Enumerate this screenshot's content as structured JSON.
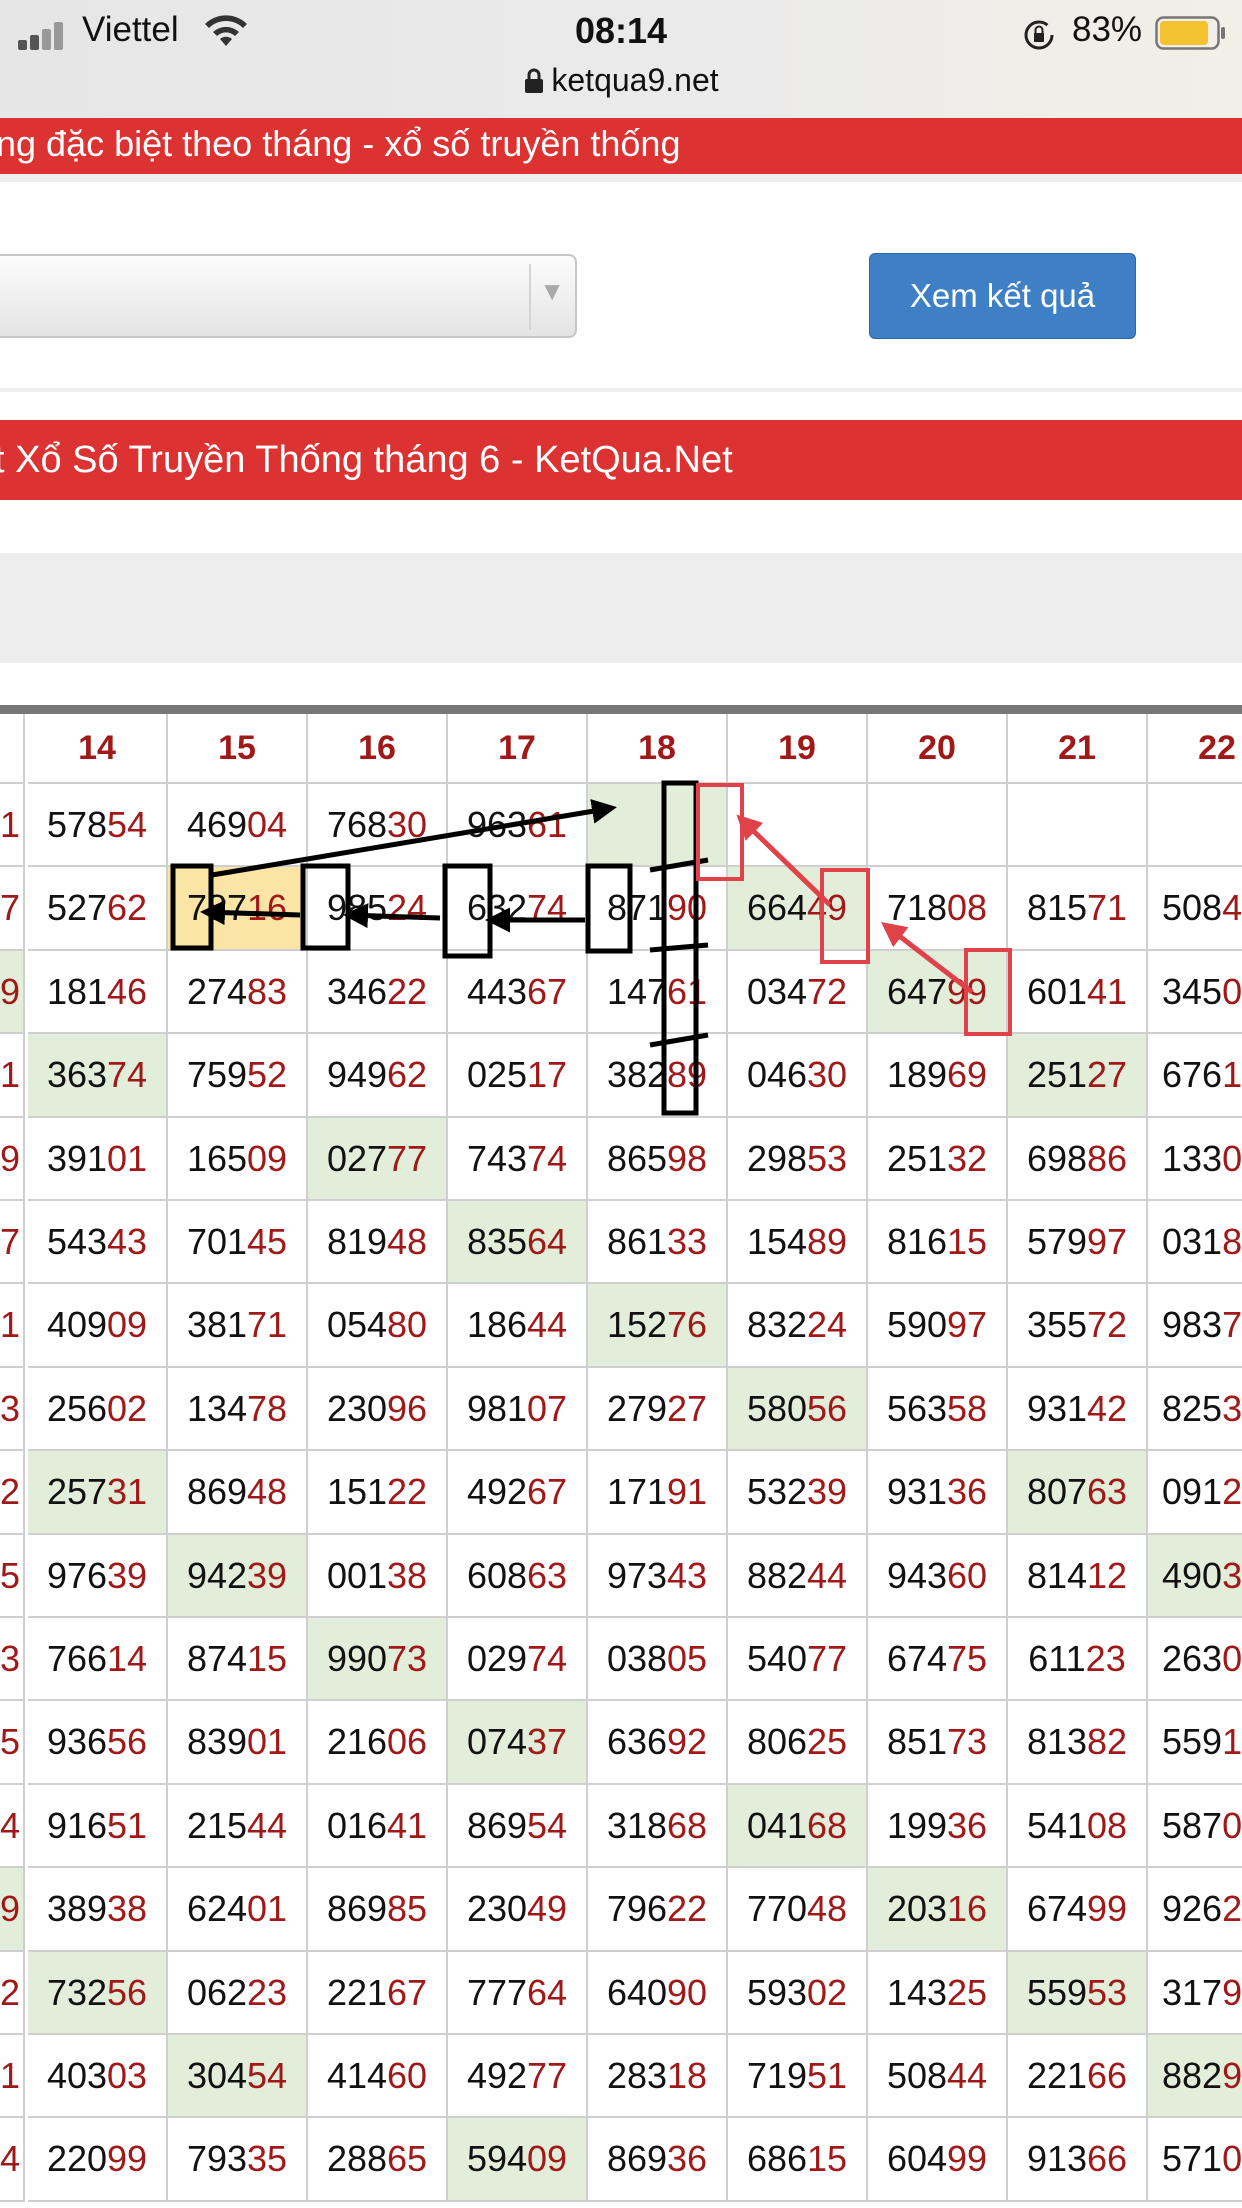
{
  "status_bar": {
    "carrier": "Viettel",
    "time": "08:14",
    "battery": "83%",
    "url": "ketqua9.net",
    "icons": [
      "signal-icon",
      "wifi-icon",
      "rotation-lock-icon",
      "battery-icon",
      "lock-icon"
    ]
  },
  "banner_top": {
    "title": "ng đặc biệt theo tháng - xổ số truyền thống"
  },
  "filter": {
    "select_value": "",
    "submit_label": "Xem kết quả"
  },
  "banner_results": {
    "title": "t Xổ Số Truyền Thống tháng 6 - KetQua.Net"
  },
  "colors": {
    "banner": "#dc3232",
    "button": "#3f7fc5",
    "tail_digits": "#a01818",
    "highlight": "#e2eed9",
    "highlight_yellow": "#fbe5a6",
    "annotation_red": "#e0424a",
    "annotation_black": "#000000"
  },
  "table": {
    "headers": [
      "",
      "14",
      "15",
      "16",
      "17",
      "18",
      "19",
      "20",
      "21",
      "22"
    ],
    "rows": [
      [
        {
          "l": "",
          "t": "1"
        },
        {
          "l": "578",
          "t": "54"
        },
        {
          "l": "469",
          "t": "04"
        },
        {
          "l": "768",
          "t": "30"
        },
        {
          "l": "963",
          "t": "61"
        },
        {
          "l": "",
          "t": "",
          "h": 1
        },
        {
          "l": "",
          "t": ""
        },
        {
          "l": "",
          "t": ""
        },
        {
          "l": "",
          "t": ""
        },
        {
          "l": "",
          "t": ""
        }
      ],
      [
        {
          "l": "",
          "t": "7"
        },
        {
          "l": "527",
          "t": "62"
        },
        {
          "l": "787",
          "t": "16",
          "h": 2
        },
        {
          "l": "985",
          "t": "24"
        },
        {
          "l": "632",
          "t": "74"
        },
        {
          "l": "871",
          "t": "90"
        },
        {
          "l": "664",
          "t": "49",
          "h": 1
        },
        {
          "l": "718",
          "t": "08"
        },
        {
          "l": "815",
          "t": "71"
        },
        {
          "l": "508",
          "t": "4"
        }
      ],
      [
        {
          "l": "",
          "t": "9",
          "h": 1
        },
        {
          "l": "181",
          "t": "46"
        },
        {
          "l": "274",
          "t": "83"
        },
        {
          "l": "346",
          "t": "22"
        },
        {
          "l": "443",
          "t": "67"
        },
        {
          "l": "147",
          "t": "61"
        },
        {
          "l": "034",
          "t": "72"
        },
        {
          "l": "647",
          "t": "99",
          "h": 1
        },
        {
          "l": "601",
          "t": "41"
        },
        {
          "l": "345",
          "t": "0"
        }
      ],
      [
        {
          "l": "",
          "t": "1"
        },
        {
          "l": "363",
          "t": "74",
          "h": 1
        },
        {
          "l": "759",
          "t": "52"
        },
        {
          "l": "949",
          "t": "62"
        },
        {
          "l": "025",
          "t": "17"
        },
        {
          "l": "382",
          "t": "89"
        },
        {
          "l": "046",
          "t": "30"
        },
        {
          "l": "189",
          "t": "69"
        },
        {
          "l": "251",
          "t": "27",
          "h": 1
        },
        {
          "l": "676",
          "t": "1"
        }
      ],
      [
        {
          "l": "",
          "t": "9"
        },
        {
          "l": "391",
          "t": "01"
        },
        {
          "l": "165",
          "t": "09"
        },
        {
          "l": "027",
          "t": "77",
          "h": 1
        },
        {
          "l": "743",
          "t": "74"
        },
        {
          "l": "865",
          "t": "98"
        },
        {
          "l": "298",
          "t": "53"
        },
        {
          "l": "251",
          "t": "32"
        },
        {
          "l": "698",
          "t": "86"
        },
        {
          "l": "133",
          "t": "0"
        }
      ],
      [
        {
          "l": "",
          "t": "7"
        },
        {
          "l": "543",
          "t": "43"
        },
        {
          "l": "701",
          "t": "45"
        },
        {
          "l": "819",
          "t": "48"
        },
        {
          "l": "835",
          "t": "64",
          "h": 1
        },
        {
          "l": "861",
          "t": "33"
        },
        {
          "l": "154",
          "t": "89"
        },
        {
          "l": "816",
          "t": "15"
        },
        {
          "l": "579",
          "t": "97"
        },
        {
          "l": "031",
          "t": "8"
        }
      ],
      [
        {
          "l": "",
          "t": "1"
        },
        {
          "l": "409",
          "t": "09"
        },
        {
          "l": "381",
          "t": "71"
        },
        {
          "l": "054",
          "t": "80"
        },
        {
          "l": "186",
          "t": "44"
        },
        {
          "l": "152",
          "t": "76",
          "h": 1
        },
        {
          "l": "832",
          "t": "24"
        },
        {
          "l": "590",
          "t": "97"
        },
        {
          "l": "355",
          "t": "72"
        },
        {
          "l": "983",
          "t": "7"
        }
      ],
      [
        {
          "l": "",
          "t": "3"
        },
        {
          "l": "256",
          "t": "02"
        },
        {
          "l": "134",
          "t": "78"
        },
        {
          "l": "230",
          "t": "96"
        },
        {
          "l": "981",
          "t": "07"
        },
        {
          "l": "279",
          "t": "27"
        },
        {
          "l": "580",
          "t": "56",
          "h": 1
        },
        {
          "l": "563",
          "t": "58"
        },
        {
          "l": "931",
          "t": "42"
        },
        {
          "l": "825",
          "t": "3"
        }
      ],
      [
        {
          "l": "",
          "t": "2"
        },
        {
          "l": "257",
          "t": "31",
          "h": 1
        },
        {
          "l": "869",
          "t": "48"
        },
        {
          "l": "151",
          "t": "22"
        },
        {
          "l": "492",
          "t": "67"
        },
        {
          "l": "171",
          "t": "91"
        },
        {
          "l": "532",
          "t": "39"
        },
        {
          "l": "931",
          "t": "36"
        },
        {
          "l": "807",
          "t": "63",
          "h": 1
        },
        {
          "l": "091",
          "t": "2"
        }
      ],
      [
        {
          "l": "",
          "t": "5"
        },
        {
          "l": "976",
          "t": "39"
        },
        {
          "l": "942",
          "t": "39",
          "h": 1
        },
        {
          "l": "001",
          "t": "38"
        },
        {
          "l": "608",
          "t": "63"
        },
        {
          "l": "973",
          "t": "43"
        },
        {
          "l": "882",
          "t": "44"
        },
        {
          "l": "943",
          "t": "60"
        },
        {
          "l": "814",
          "t": "12"
        },
        {
          "l": "490",
          "t": "3",
          "h": 1
        }
      ],
      [
        {
          "l": "",
          "t": "3"
        },
        {
          "l": "766",
          "t": "14"
        },
        {
          "l": "874",
          "t": "15"
        },
        {
          "l": "990",
          "t": "73",
          "h": 1
        },
        {
          "l": "029",
          "t": "74"
        },
        {
          "l": "038",
          "t": "05"
        },
        {
          "l": "540",
          "t": "77"
        },
        {
          "l": "674",
          "t": "75"
        },
        {
          "l": "611",
          "t": "23"
        },
        {
          "l": "263",
          "t": "0"
        }
      ],
      [
        {
          "l": "",
          "t": "5"
        },
        {
          "l": "936",
          "t": "56"
        },
        {
          "l": "839",
          "t": "01"
        },
        {
          "l": "216",
          "t": "06"
        },
        {
          "l": "074",
          "t": "37",
          "h": 1
        },
        {
          "l": "636",
          "t": "92"
        },
        {
          "l": "806",
          "t": "25"
        },
        {
          "l": "851",
          "t": "73"
        },
        {
          "l": "813",
          "t": "82"
        },
        {
          "l": "559",
          "t": "1"
        }
      ],
      [
        {
          "l": "",
          "t": "4"
        },
        {
          "l": "916",
          "t": "51"
        },
        {
          "l": "215",
          "t": "44"
        },
        {
          "l": "016",
          "t": "41"
        },
        {
          "l": "869",
          "t": "54"
        },
        {
          "l": "318",
          "t": "68"
        },
        {
          "l": "041",
          "t": "68",
          "h": 1
        },
        {
          "l": "199",
          "t": "36"
        },
        {
          "l": "541",
          "t": "08"
        },
        {
          "l": "587",
          "t": "0"
        }
      ],
      [
        {
          "l": "",
          "t": "9",
          "h": 1
        },
        {
          "l": "389",
          "t": "38"
        },
        {
          "l": "624",
          "t": "01"
        },
        {
          "l": "869",
          "t": "85"
        },
        {
          "l": "230",
          "t": "49"
        },
        {
          "l": "796",
          "t": "22"
        },
        {
          "l": "770",
          "t": "48"
        },
        {
          "l": "203",
          "t": "16",
          "h": 1
        },
        {
          "l": "674",
          "t": "99"
        },
        {
          "l": "926",
          "t": "2"
        }
      ],
      [
        {
          "l": "",
          "t": "2"
        },
        {
          "l": "732",
          "t": "56",
          "h": 1
        },
        {
          "l": "062",
          "t": "23"
        },
        {
          "l": "221",
          "t": "67"
        },
        {
          "l": "777",
          "t": "64"
        },
        {
          "l": "640",
          "t": "90"
        },
        {
          "l": "593",
          "t": "02"
        },
        {
          "l": "143",
          "t": "25"
        },
        {
          "l": "559",
          "t": "53",
          "h": 1
        },
        {
          "l": "317",
          "t": "9"
        }
      ],
      [
        {
          "l": "",
          "t": "1"
        },
        {
          "l": "403",
          "t": "03"
        },
        {
          "l": "304",
          "t": "54",
          "h": 1
        },
        {
          "l": "414",
          "t": "60"
        },
        {
          "l": "492",
          "t": "77"
        },
        {
          "l": "283",
          "t": "18"
        },
        {
          "l": "719",
          "t": "51"
        },
        {
          "l": "508",
          "t": "44"
        },
        {
          "l": "221",
          "t": "66"
        },
        {
          "l": "882",
          "t": "9",
          "h": 1
        }
      ],
      [
        {
          "l": "",
          "t": "4"
        },
        {
          "l": "220",
          "t": "99"
        },
        {
          "l": "793",
          "t": "35"
        },
        {
          "l": "288",
          "t": "65"
        },
        {
          "l": "594",
          "t": "09",
          "h": 1
        },
        {
          "l": "869",
          "t": "36"
        },
        {
          "l": "686",
          "t": "15"
        },
        {
          "l": "604",
          "t": "99"
        },
        {
          "l": "913",
          "t": "66"
        },
        {
          "l": "571",
          "t": "0"
        }
      ]
    ]
  }
}
